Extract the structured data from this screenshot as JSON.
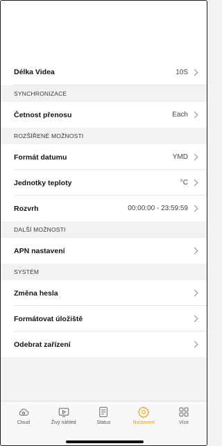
{
  "settings": {
    "video_length": {
      "label": "Délka Videa",
      "value": "10S"
    },
    "sync_header": "SYNCHRONIZACE",
    "transfer_frequency": {
      "label": "Četnost přenosu",
      "value": "Each"
    },
    "advanced_header": "ROZŠÍŘENÉ MOŽNOSTI",
    "date_format": {
      "label": "Formát datumu",
      "value": "YMD"
    },
    "temperature_units": {
      "label": "Jednotky teploty",
      "value": "°C"
    },
    "schedule": {
      "label": "Rozvrh",
      "value": "00:00:00 - 23:59:59"
    },
    "more_header": "DALŠÍ MOŽNOSTI",
    "apn": {
      "label": "APN nastavení"
    },
    "system_header": "SYSTÉM",
    "change_password": {
      "label": "Změna hesla"
    },
    "format_storage": {
      "label": "Formátovat úložiště"
    },
    "remove_device": {
      "label": "Odebrat zařízení"
    }
  },
  "tabbar": {
    "active_color": "#e0a018",
    "items": [
      {
        "label": "Cloud",
        "icon": "cloud-icon"
      },
      {
        "label": "Živý náhled",
        "icon": "live-view-icon"
      },
      {
        "label": "Status",
        "icon": "status-icon"
      },
      {
        "label": "Nastavení",
        "icon": "gear-icon",
        "active": true
      },
      {
        "label": "Více",
        "icon": "more-grid-icon"
      }
    ]
  }
}
